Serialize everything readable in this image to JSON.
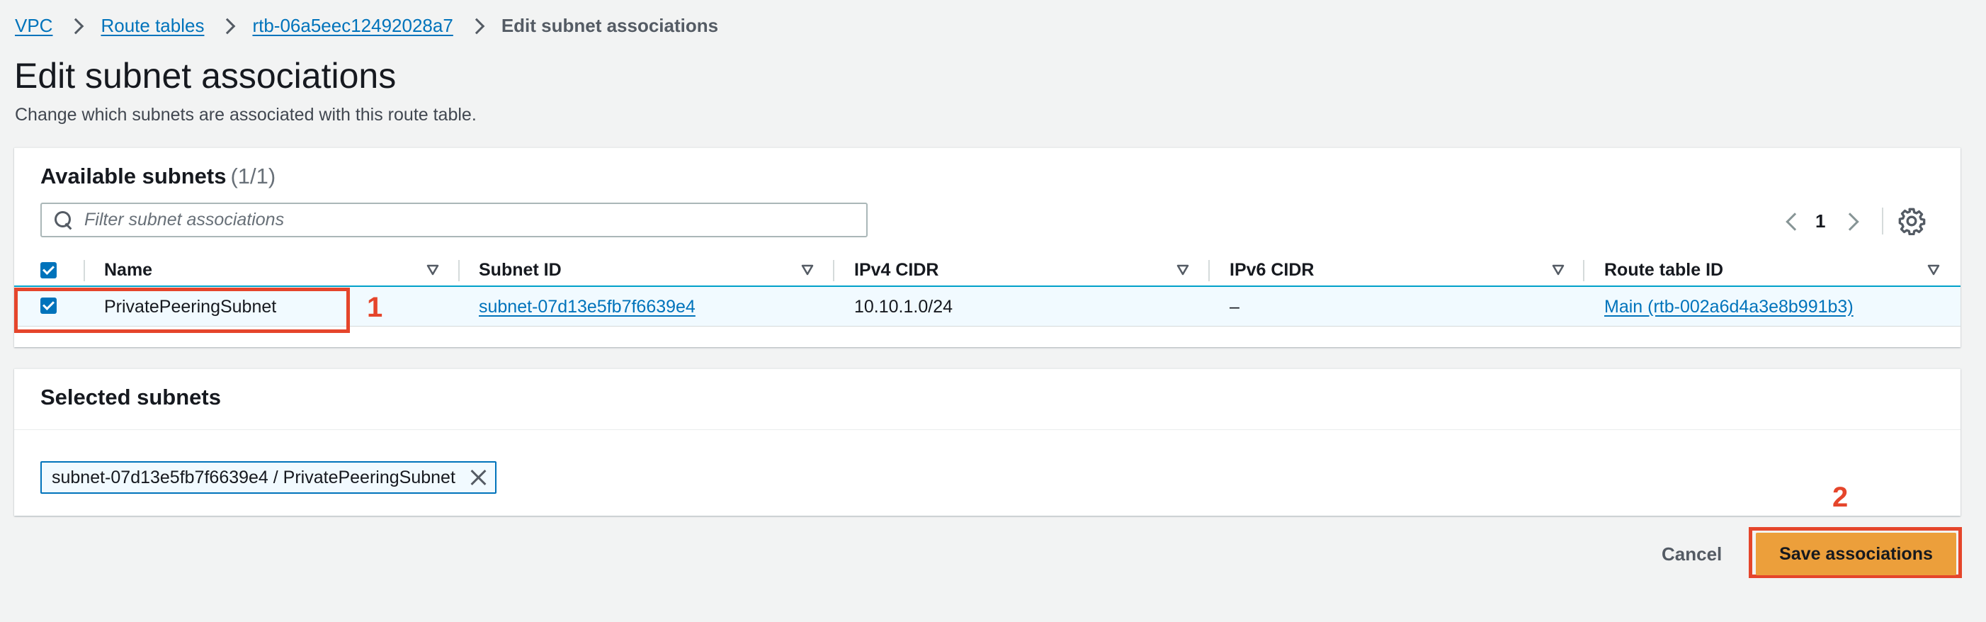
{
  "breadcrumb": {
    "items": [
      "VPC",
      "Route tables",
      "rtb-06a5eec12492028a7"
    ],
    "current": "Edit subnet associations"
  },
  "header": {
    "title": "Edit subnet associations",
    "description": "Change which subnets are associated with this route table."
  },
  "available_subnets": {
    "title": "Available subnets",
    "count": "(1/1)",
    "filter_placeholder": "Filter subnet associations",
    "filter_value": "",
    "pagination": {
      "page": "1"
    },
    "columns": [
      "Name",
      "Subnet ID",
      "IPv4 CIDR",
      "IPv6 CIDR",
      "Route table ID"
    ],
    "rows": [
      {
        "selected": true,
        "name": "PrivatePeeringSubnet",
        "subnet_id": "subnet-07d13e5fb7f6639e4",
        "ipv4_cidr": "10.10.1.0/24",
        "ipv6_cidr": "–",
        "route_table_id": "Main (rtb-002a6d4a3e8b991b3)"
      }
    ]
  },
  "selected_subnets": {
    "title": "Selected subnets",
    "tokens": [
      "subnet-07d13e5fb7f6639e4 / PrivatePeeringSubnet"
    ]
  },
  "actions": {
    "cancel_label": "Cancel",
    "save_label": "Save associations"
  },
  "annotations": {
    "step1": "1",
    "step2": "2"
  },
  "colors": {
    "link": "#0073bb",
    "primary_button": "#ec9f3b",
    "annotation": "#e5452b",
    "selected_row": "#f1faff"
  },
  "icons": [
    "chevron-right-icon",
    "search-icon",
    "chevron-left-icon",
    "gear-icon",
    "sort-down-icon",
    "close-icon",
    "checkbox-checked-icon"
  ]
}
